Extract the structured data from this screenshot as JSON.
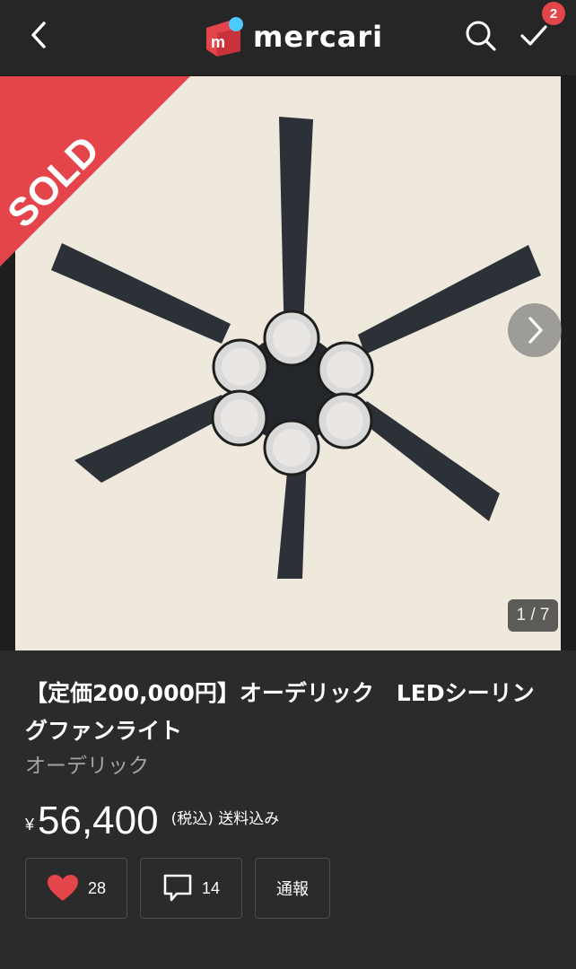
{
  "header": {
    "logo_text": "mercari",
    "notification_count": "2",
    "colors": {
      "logo_red": "#e4454b",
      "logo_blue": "#4dc9ff",
      "badge": "#e4454b"
    }
  },
  "gallery": {
    "sold_label": "SOLD",
    "counter": "1 / 7",
    "icons": [
      "chevron-right-icon"
    ]
  },
  "item": {
    "title": "【定価200,000円】オーデリック　LEDシーリングファンライト",
    "brand": "オーデリック",
    "currency": "¥",
    "price": "56,400",
    "tax_note": "(税込) 送料込み"
  },
  "actions": {
    "like_count": "28",
    "comment_count": "14",
    "report_label": "通報"
  }
}
